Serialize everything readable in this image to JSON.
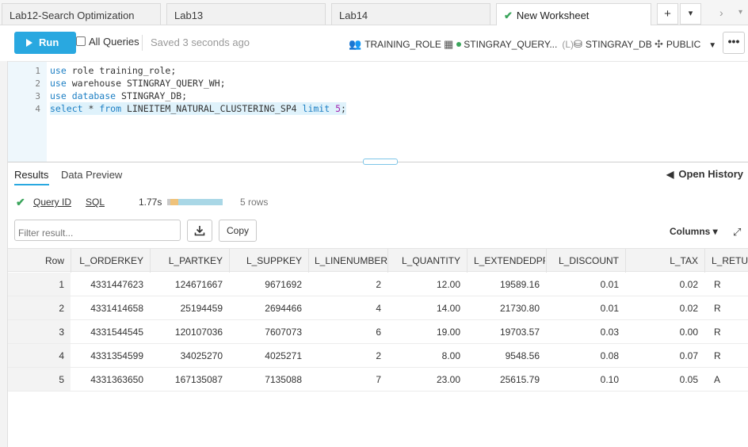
{
  "tabs": [
    {
      "label": "Lab12-Search Optimization"
    },
    {
      "label": "Lab13"
    },
    {
      "label": "Lab14"
    },
    {
      "label": "New Worksheet",
      "active": true
    }
  ],
  "tab_controls": {
    "add": "+",
    "menu": "▾",
    "next": "›",
    "more": "▾"
  },
  "toolbar": {
    "run_label": "Run",
    "all_queries_label": "All Queries",
    "saved_status": "Saved 3 seconds ago",
    "role": "TRAINING_ROLE",
    "warehouse": "STINGRAY_QUERY...",
    "warehouse_size": "(L)",
    "database": "STINGRAY_DB",
    "schema": "PUBLIC",
    "more_label": "•••"
  },
  "editor": {
    "lines": [
      {
        "num": "1",
        "keyword": "use",
        "rest": " role training_role;"
      },
      {
        "num": "2",
        "keyword": "use",
        "rest": " warehouse STINGRAY_QUERY_WH;"
      },
      {
        "num": "3",
        "keyword": "use database",
        "rest": " STINGRAY_DB;"
      },
      {
        "num": "4",
        "kw1": "select",
        "mid1": " * ",
        "kw2": "from",
        "mid2": " LINEITEM_NATURAL_CLUSTERING_SP4 ",
        "kw3": "limit",
        "sp": " ",
        "numval": "5",
        "end": ";"
      }
    ]
  },
  "results": {
    "tab_results": "Results",
    "tab_preview": "Data Preview",
    "open_history": "Open History",
    "query_id_label": "Query ID",
    "sql_label": "SQL",
    "duration": "1.77s",
    "row_count": "5 rows",
    "filter_placeholder": "Filter result...",
    "copy_label": "Copy",
    "columns_label": "Columns ▾"
  },
  "table": {
    "headers": [
      "Row",
      "L_ORDERKEY",
      "L_PARTKEY",
      "L_SUPPKEY",
      "L_LINENUMBER",
      "L_QUANTITY",
      "L_EXTENDEDPR",
      "L_DISCOUNT",
      "L_TAX",
      "L_RETUR"
    ],
    "rows": [
      [
        "1",
        "4331447623",
        "124671667",
        "9671692",
        "2",
        "12.00",
        "19589.16",
        "0.01",
        "0.02",
        "R"
      ],
      [
        "2",
        "4331414658",
        "25194459",
        "2694466",
        "4",
        "14.00",
        "21730.80",
        "0.01",
        "0.02",
        "R"
      ],
      [
        "3",
        "4331544545",
        "120107036",
        "7607073",
        "6",
        "19.00",
        "19703.57",
        "0.03",
        "0.00",
        "R"
      ],
      [
        "4",
        "4331354599",
        "34025270",
        "4025271",
        "2",
        "8.00",
        "9548.56",
        "0.08",
        "0.07",
        "R"
      ],
      [
        "5",
        "4331363650",
        "167135087",
        "7135088",
        "7",
        "23.00",
        "25615.79",
        "0.10",
        "0.05",
        "A"
      ]
    ]
  }
}
